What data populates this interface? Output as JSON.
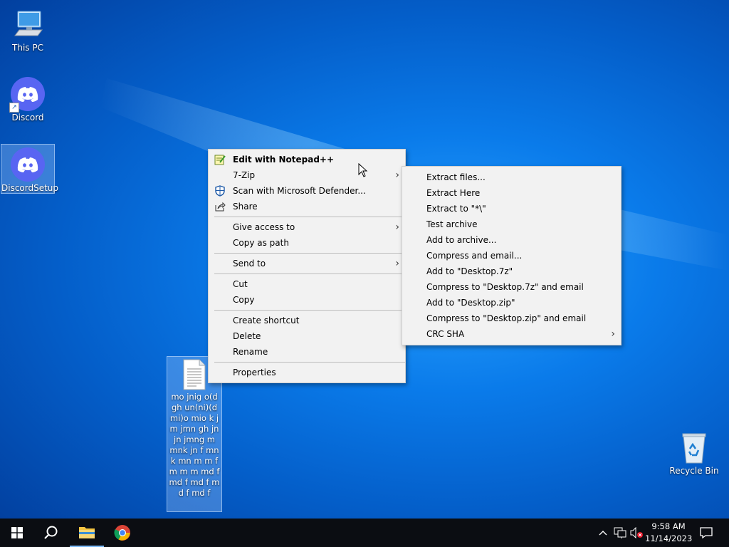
{
  "desktop": {
    "icons": [
      {
        "label": "This PC"
      },
      {
        "label": "Discord"
      },
      {
        "label": "DiscordSetup"
      },
      {
        "label": "mo jnig o(dgh un(ni)(d mi)o mio k jm jmn gh jn jn jmng m mnk jn f mnk mn m m f m m m md f md f md f md f md f"
      },
      {
        "label": "Recycle Bin"
      }
    ]
  },
  "context_menu": {
    "items": [
      {
        "label": "Edit with Notepad++",
        "icon": "notepad-plus-plus-icon"
      },
      {
        "label": "7-Zip",
        "submenu": true
      },
      {
        "label": "Scan with Microsoft Defender...",
        "icon": "defender-shield-icon"
      },
      {
        "label": "Share",
        "icon": "share-icon"
      },
      {
        "label": "Give access to",
        "submenu": true
      },
      {
        "label": "Copy as path"
      },
      {
        "label": "Send to",
        "submenu": true
      },
      {
        "label": "Cut"
      },
      {
        "label": "Copy"
      },
      {
        "label": "Create shortcut"
      },
      {
        "label": "Delete"
      },
      {
        "label": "Rename"
      },
      {
        "label": "Properties"
      }
    ]
  },
  "zip_submenu": {
    "items": [
      {
        "label": "Extract files..."
      },
      {
        "label": "Extract Here"
      },
      {
        "label": "Extract to \"*\\\""
      },
      {
        "label": "Test archive"
      },
      {
        "label": "Add to archive..."
      },
      {
        "label": "Compress and email..."
      },
      {
        "label": "Add to \"Desktop.7z\""
      },
      {
        "label": "Compress to \"Desktop.7z\" and email"
      },
      {
        "label": "Add to \"Desktop.zip\""
      },
      {
        "label": "Compress to \"Desktop.zip\" and email"
      },
      {
        "label": "CRC SHA",
        "submenu": true
      }
    ]
  },
  "taskbar": {
    "apps": [
      "start-icon",
      "search-icon",
      "file-explorer-icon",
      "chrome-icon"
    ],
    "tray": [
      "chevron-up-icon",
      "network-icon",
      "volume-muted-icon"
    ],
    "time": "9:58 AM",
    "date": "11/14/2023",
    "notification_icon": "action-center-icon"
  },
  "colors": {
    "desktop_blue": "#0a7bea",
    "discord": "#5865f2",
    "taskbar": "#0b0d12",
    "menu_bg": "#f2f2f2"
  }
}
